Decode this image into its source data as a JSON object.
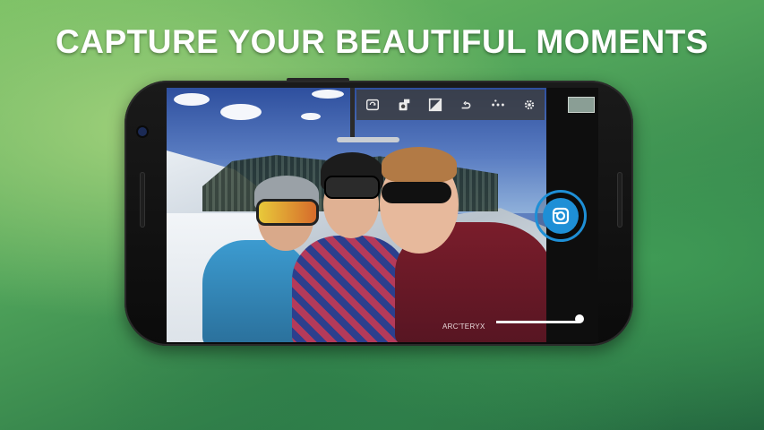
{
  "headline": "CAPTURE YOUR BEAUTIFUL MOMENTS",
  "photo": {
    "jacket_brand": "ARC'TERYX"
  },
  "toolbar": {
    "icons": [
      "switch-camera-icon",
      "flash-mode-icon",
      "exposure-icon",
      "timer-icon",
      "scene-mode-icon",
      "settings-icon"
    ]
  },
  "controls": {
    "shutter_icon": "camera-shutter-icon",
    "zoom_level_fraction": 0.96
  },
  "colors": {
    "accent": "#1e8fd6",
    "phone_body": "#111111",
    "background_green": "#4fa35a"
  }
}
